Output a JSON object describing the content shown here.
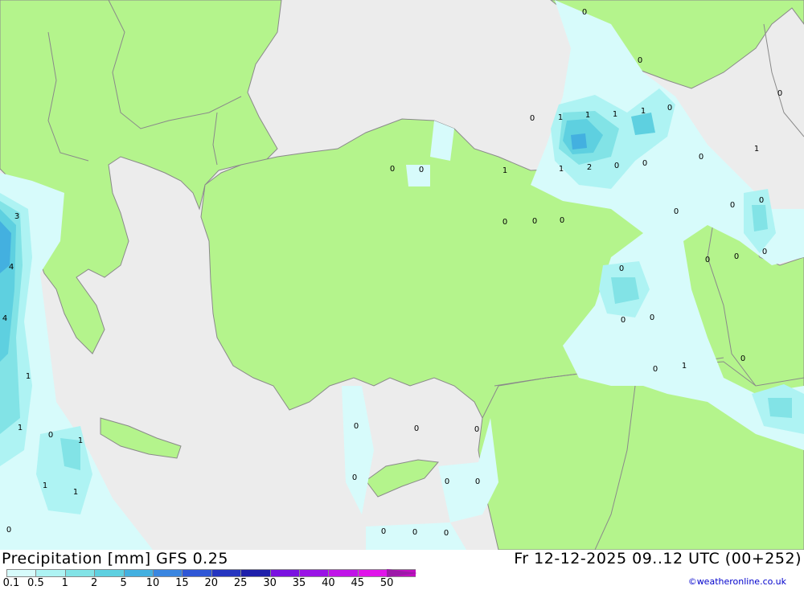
{
  "header": {
    "product": "Precipitation [mm]  GFS 0.25",
    "valid_time": "Fr 12-12-2025 09..12 UTC (00+252)",
    "credit": "©weatheronline.co.uk"
  },
  "legend": {
    "labels": [
      "0.1",
      "0.5",
      "1",
      "2",
      "5",
      "10",
      "15",
      "20",
      "25",
      "30",
      "35",
      "40",
      "45",
      "50"
    ],
    "colors": [
      "#d7fbfb",
      "#aef3f3",
      "#82e3e6",
      "#5ed0e0",
      "#43b0e0",
      "#3a86e0",
      "#2f57d6",
      "#2535c0",
      "#1e1faa",
      "#7a12e0",
      "#9a14e6",
      "#c014e8",
      "#e014ea",
      "#c010c0"
    ]
  },
  "colors": {
    "land": "#b4f48c",
    "sea": "#ececec",
    "border": "#8a8a8a"
  },
  "map_values": [
    {
      "label": "0"
    },
    {
      "label": "0"
    },
    {
      "label": "0"
    },
    {
      "label": "0"
    },
    {
      "label": "1"
    },
    {
      "label": "1"
    },
    {
      "label": "1"
    },
    {
      "label": "1"
    },
    {
      "label": "0"
    },
    {
      "label": "0"
    },
    {
      "label": "0"
    },
    {
      "label": "1"
    },
    {
      "label": "1"
    },
    {
      "label": "2"
    },
    {
      "label": "0"
    },
    {
      "label": "0"
    },
    {
      "label": "0"
    },
    {
      "label": "1"
    },
    {
      "label": "0"
    },
    {
      "label": "0"
    },
    {
      "label": "0"
    },
    {
      "label": "0"
    },
    {
      "label": "0"
    },
    {
      "label": "0"
    },
    {
      "label": "0"
    },
    {
      "label": "0"
    },
    {
      "label": "0"
    },
    {
      "label": "0"
    },
    {
      "label": "0"
    },
    {
      "label": "0"
    },
    {
      "label": "0"
    },
    {
      "label": "0"
    },
    {
      "label": "1"
    },
    {
      "label": "3"
    },
    {
      "label": "4"
    },
    {
      "label": "4"
    },
    {
      "label": "1"
    },
    {
      "label": "1"
    },
    {
      "label": "0"
    },
    {
      "label": "1"
    },
    {
      "label": "1"
    },
    {
      "label": "1"
    },
    {
      "label": "0"
    },
    {
      "label": "0"
    },
    {
      "label": "0"
    },
    {
      "label": "0"
    },
    {
      "label": "0"
    },
    {
      "label": "0"
    },
    {
      "label": "0"
    },
    {
      "label": "0"
    },
    {
      "label": "0"
    },
    {
      "label": "0"
    }
  ]
}
